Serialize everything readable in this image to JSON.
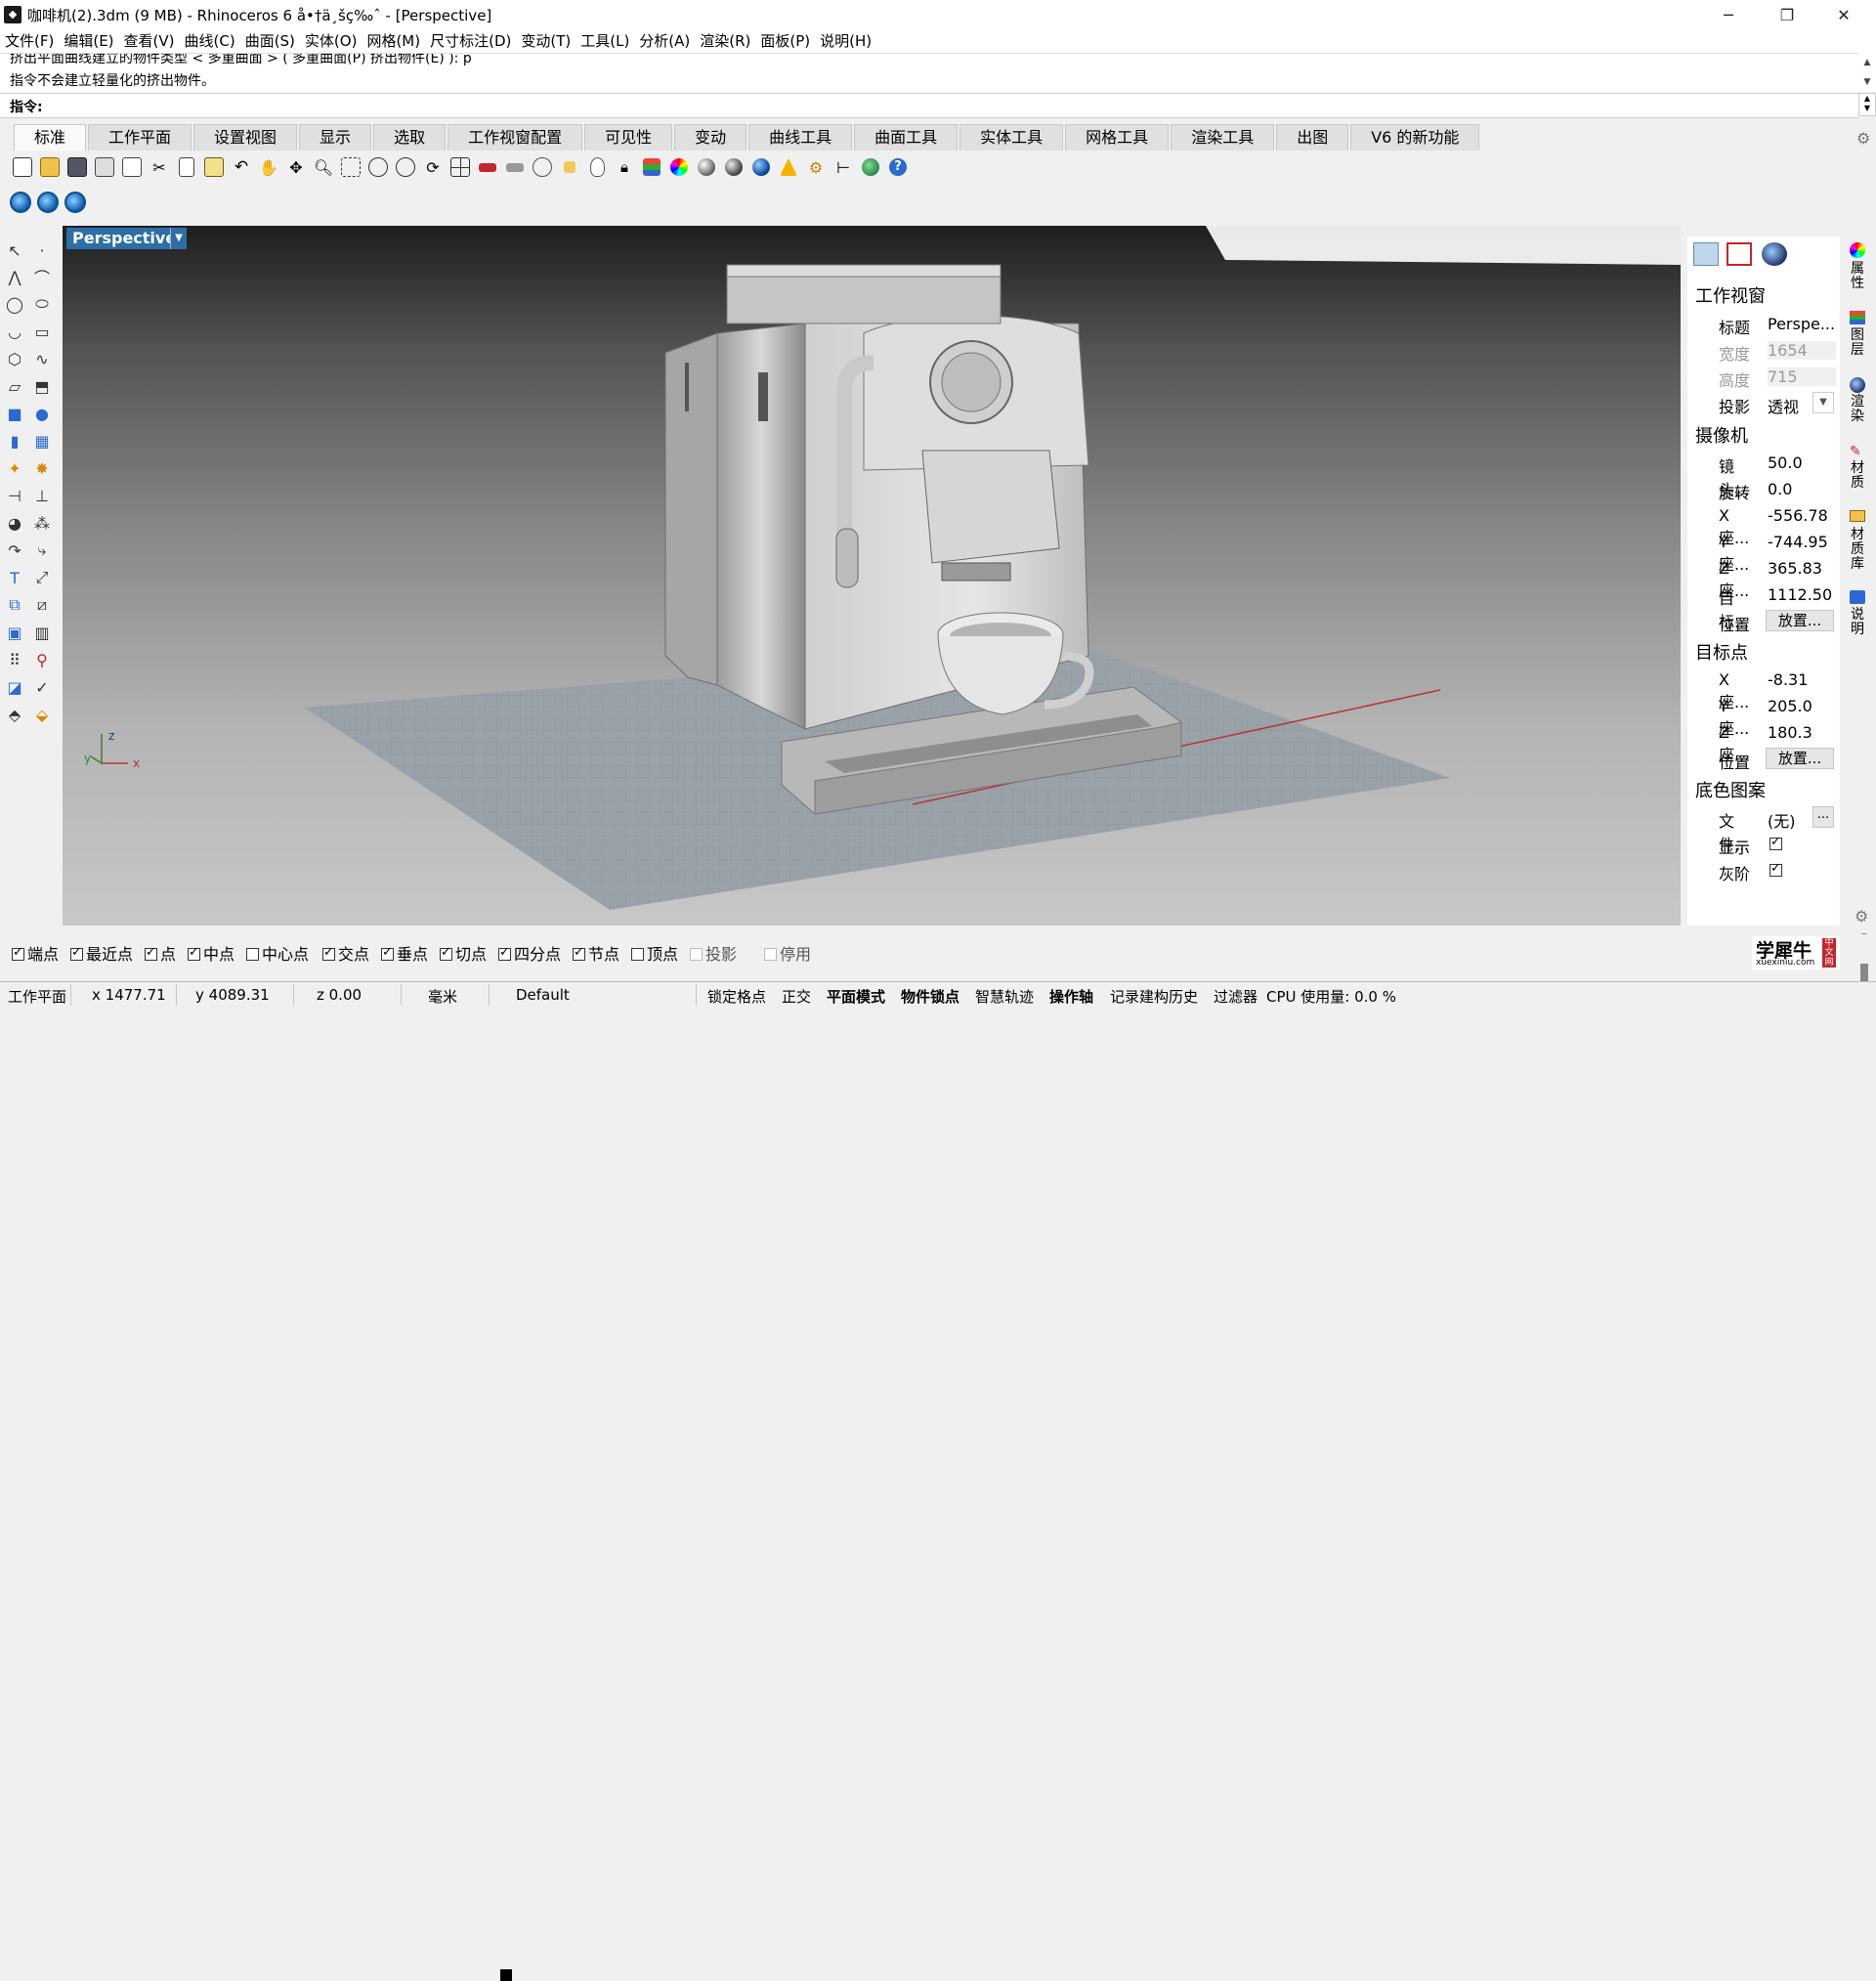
{
  "window": {
    "title": "咖啡机(2).3dm (9 MB) - Rhinoceros 6 å•†ä¸šç‰ˆ - [Perspective]",
    "minimize": "─",
    "maximize": "❐",
    "close": "✕"
  },
  "menu": [
    "文件(F)",
    "编辑(E)",
    "查看(V)",
    "曲线(C)",
    "曲面(S)",
    "实体(O)",
    "网格(M)",
    "尺寸标注(D)",
    "变动(T)",
    "工具(L)",
    "分析(A)",
    "渲染(R)",
    "面板(P)",
    "说明(H)"
  ],
  "command": {
    "history_line1": "挤出平面曲线建立的物件类型 < 多重曲面 > ( 多重曲面(P) 挤出物件(E) ): p",
    "history_line2": "指令不会建立轻量化的挤出物件。",
    "prompt_label": "指令:",
    "input_value": ""
  },
  "tabs": [
    "标准",
    "工作平面",
    "设置视图",
    "显示",
    "选取",
    "工作视窗配置",
    "可见性",
    "变动",
    "曲线工具",
    "曲面工具",
    "实体工具",
    "网格工具",
    "渲染工具",
    "出图",
    "V6 的新功能"
  ],
  "viewport": {
    "label": "Perspective",
    "axis_x": "x",
    "axis_y": "y",
    "axis_z": "z"
  },
  "properties": {
    "viewport_header": "工作视窗",
    "title_label": "标题",
    "title_value": "Perspe...",
    "width_label": "宽度",
    "width_value": "1654",
    "height_label": "高度",
    "height_value": "715",
    "projection_label": "投影",
    "projection_value": "透视",
    "camera_header": "摄像机",
    "lens_label": "镜头...",
    "lens_value": "50.0",
    "rotation_label": "旋转",
    "rotation_value": "0.0",
    "cx_label": "X 座...",
    "cx_value": "-556.78",
    "cy_label": "Y 座...",
    "cy_value": "-744.95",
    "cz_label": "Z 座...",
    "cz_value": "365.83",
    "target_dist_label": "目标...",
    "target_dist_value": "1112.50",
    "cam_position_label": "位置",
    "cam_position_button": "放置...",
    "target_header": "目标点",
    "tx_label": "X 座...",
    "tx_value": "-8.31",
    "ty_label": "Y 座...",
    "ty_value": "205.0",
    "tz_label": "Z 座...",
    "tz_value": "180.3",
    "tgt_position_label": "位置",
    "tgt_position_button": "放置...",
    "wallpaper_header": "底色图案",
    "file_label": "文件...",
    "file_value": "(无)",
    "file_button": "...",
    "show_label": "显示",
    "show_checked": true,
    "gray_label": "灰阶",
    "gray_checked": true
  },
  "side_tabs": [
    "属性",
    "图层",
    "渲染",
    "材质",
    "材质库",
    "说明"
  ],
  "osnaps": [
    {
      "label": "端点",
      "checked": true
    },
    {
      "label": "最近点",
      "checked": true
    },
    {
      "label": "点",
      "checked": true
    },
    {
      "label": "中点",
      "checked": true
    },
    {
      "label": "中心点",
      "checked": false
    },
    {
      "label": "交点",
      "checked": true
    },
    {
      "label": "垂点",
      "checked": true
    },
    {
      "label": "切点",
      "checked": true
    },
    {
      "label": "四分点",
      "checked": true
    },
    {
      "label": "节点",
      "checked": true
    },
    {
      "label": "顶点",
      "checked": false
    },
    {
      "label": "投影",
      "checked": false
    },
    {
      "label": "停用",
      "checked": false
    }
  ],
  "logo": {
    "name": "学犀牛",
    "url": "xuexiniu.com",
    "tag": "中文网"
  },
  "status": {
    "cplane": "工作平面",
    "x": "x 1477.71",
    "y": "y 4089.31",
    "z": "z 0.00",
    "units": "毫米",
    "layer": "Default",
    "grid_snap": "锁定格点",
    "ortho": "正交",
    "planar": "平面模式",
    "osnap": "物件锁点",
    "smarttrack": "智慧轨迹",
    "gumball": "操作轴",
    "history": "记录建构历史",
    "filter": "过滤器",
    "cpu": "CPU 使用量: 0.0 %"
  }
}
